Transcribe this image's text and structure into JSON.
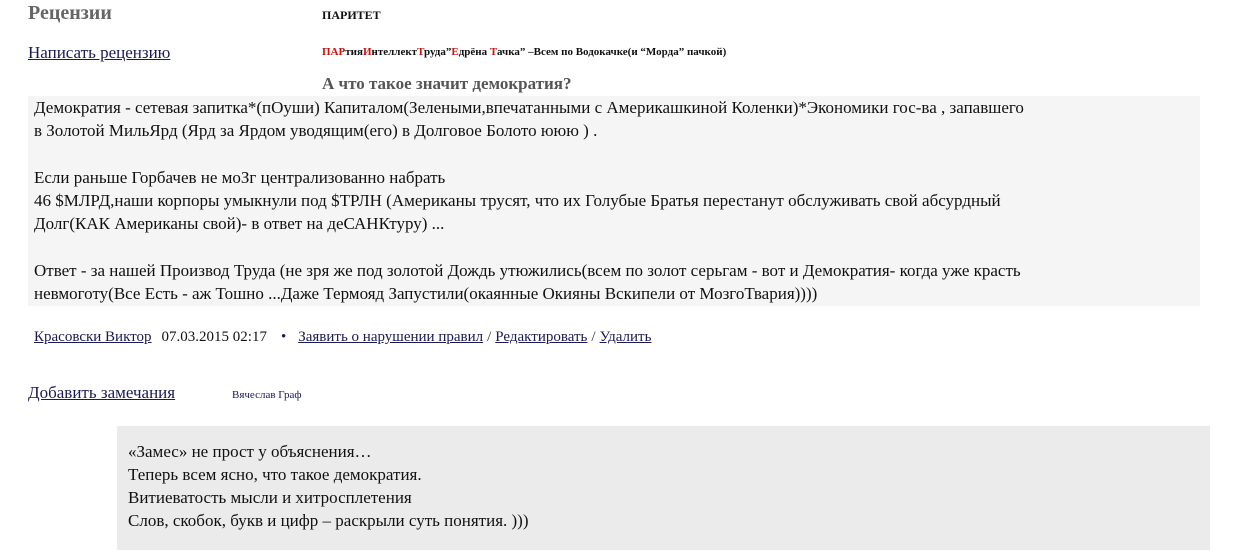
{
  "header": {
    "section_title": "Рецензии",
    "write_review": "Написать рецензию",
    "author": "ПАРИТЕТ",
    "subtitle_parts": [
      {
        "text": "ПАР",
        "red": true
      },
      {
        "text": "тия",
        "red": false
      },
      {
        "text": "И",
        "red": true
      },
      {
        "text": "нтеллект",
        "red": false
      },
      {
        "text": "Т",
        "red": true
      },
      {
        "text": "руда”",
        "red": false
      },
      {
        "text": "Е",
        "red": true
      },
      {
        "text": "дрёна ",
        "red": false
      },
      {
        "text": "Т",
        "red": true
      },
      {
        "text": "ачка” –Всем по Водокачке(и “Морда” пачкой)",
        "red": false
      }
    ],
    "piece_title": "А что такое значит демократия?"
  },
  "review": {
    "lines": [
      "Демократия - сетевая запитка*(пОуши) Капиталом(Зелеными,впечатанными с Америкашкиной Коленки)*Экономики гос-ва , запавшего",
      "в Золотой МильЯрд (Ярд за Ярдом уводящим(его) в Долговое Болото ююю ) .",
      "Если раньше Горбачев не моЗг централизованно набрать",
      "46 $МЛРД,наши корпоры умыкнули под $ТРЛН (Американы трусят, что их Голубые Братья перестанут обслуживать свой абсурдный",
      "Долг(КАК Американы свой)- в ответ на деСАНКтуру) ...",
      "Ответ - за нашей Производ Труда (не зря же под золотой Дождь утюжились(всем по золот серьгам - вот и Демократия- когда уже красть",
      "невмоготу(Все Есть - аж Тошно ...Даже Термояд Запустили(окаянные Окияны Вскипели от МозгоТвария))))"
    ],
    "meta": {
      "author": "Красовски Виктор",
      "date": "07.03.2015 02:17",
      "bullet": "•",
      "report": "Заявить о нарушении правил",
      "edit": "Редактировать",
      "delete": "Удалить",
      "slash": "/"
    }
  },
  "remarks": {
    "add_label": "Добавить замечания",
    "author": "Вячеслав Граф",
    "comment_lines": [
      "«Замес» не прост у объяснения…",
      "Теперь всем ясно, что такое демократия.",
      "Витиеватость мысли и хитросплетения",
      "Слов, скобок, букв и цифр – раскрыли суть понятия. )))"
    ]
  }
}
